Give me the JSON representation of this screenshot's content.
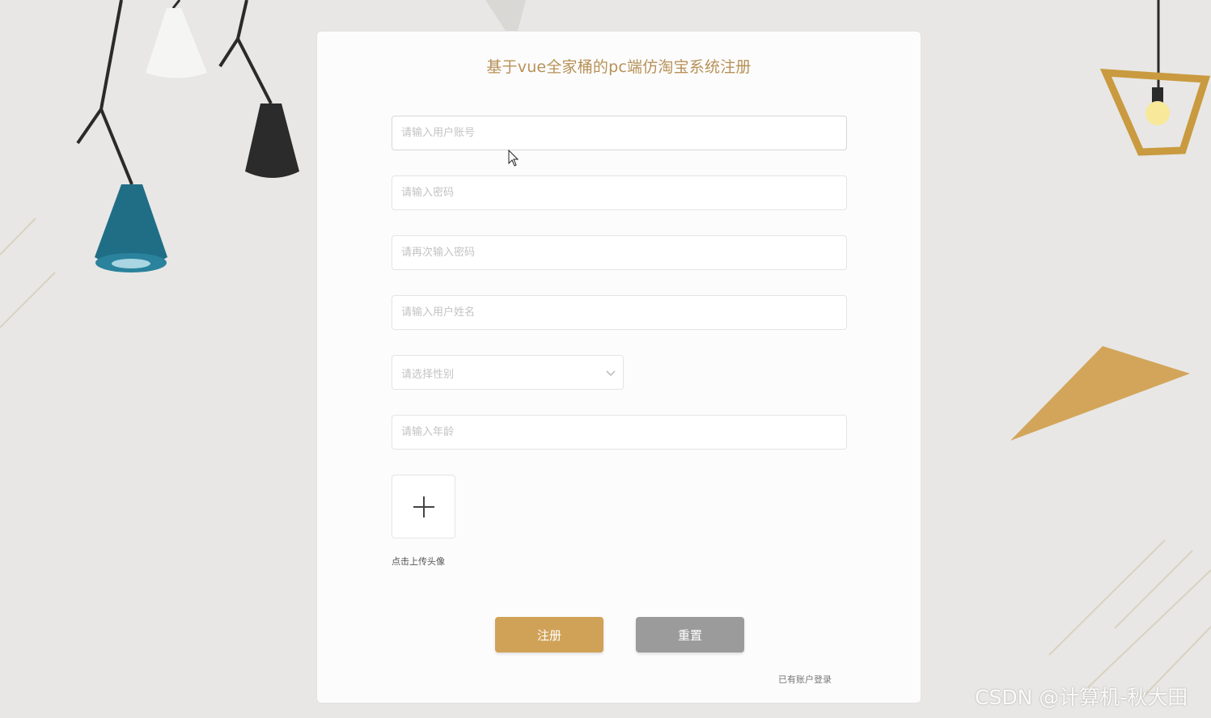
{
  "form": {
    "title": "基于vue全家桶的pc端仿淘宝系统注册",
    "account_placeholder": "请输入用户账号",
    "password_placeholder": "请输入密码",
    "confirm_password_placeholder": "请再次输入密码",
    "name_placeholder": "请输入用户姓名",
    "gender_placeholder": "请选择性别",
    "age_placeholder": "请输入年龄",
    "upload_label": "点击上传头像",
    "register_button": "注册",
    "reset_button": "重置",
    "login_link": "已有账户登录"
  },
  "watermark": "CSDN @计算机-秋大田",
  "icons": {
    "upload": "plus-icon",
    "select": "chevron-down-icon",
    "cursor": "mouse-cursor-icon"
  },
  "colors": {
    "accent": "#d0a258",
    "title": "#b79158",
    "reset": "#9b9b9b",
    "background": "#e8e7e5",
    "card": "#fcfcfc"
  }
}
